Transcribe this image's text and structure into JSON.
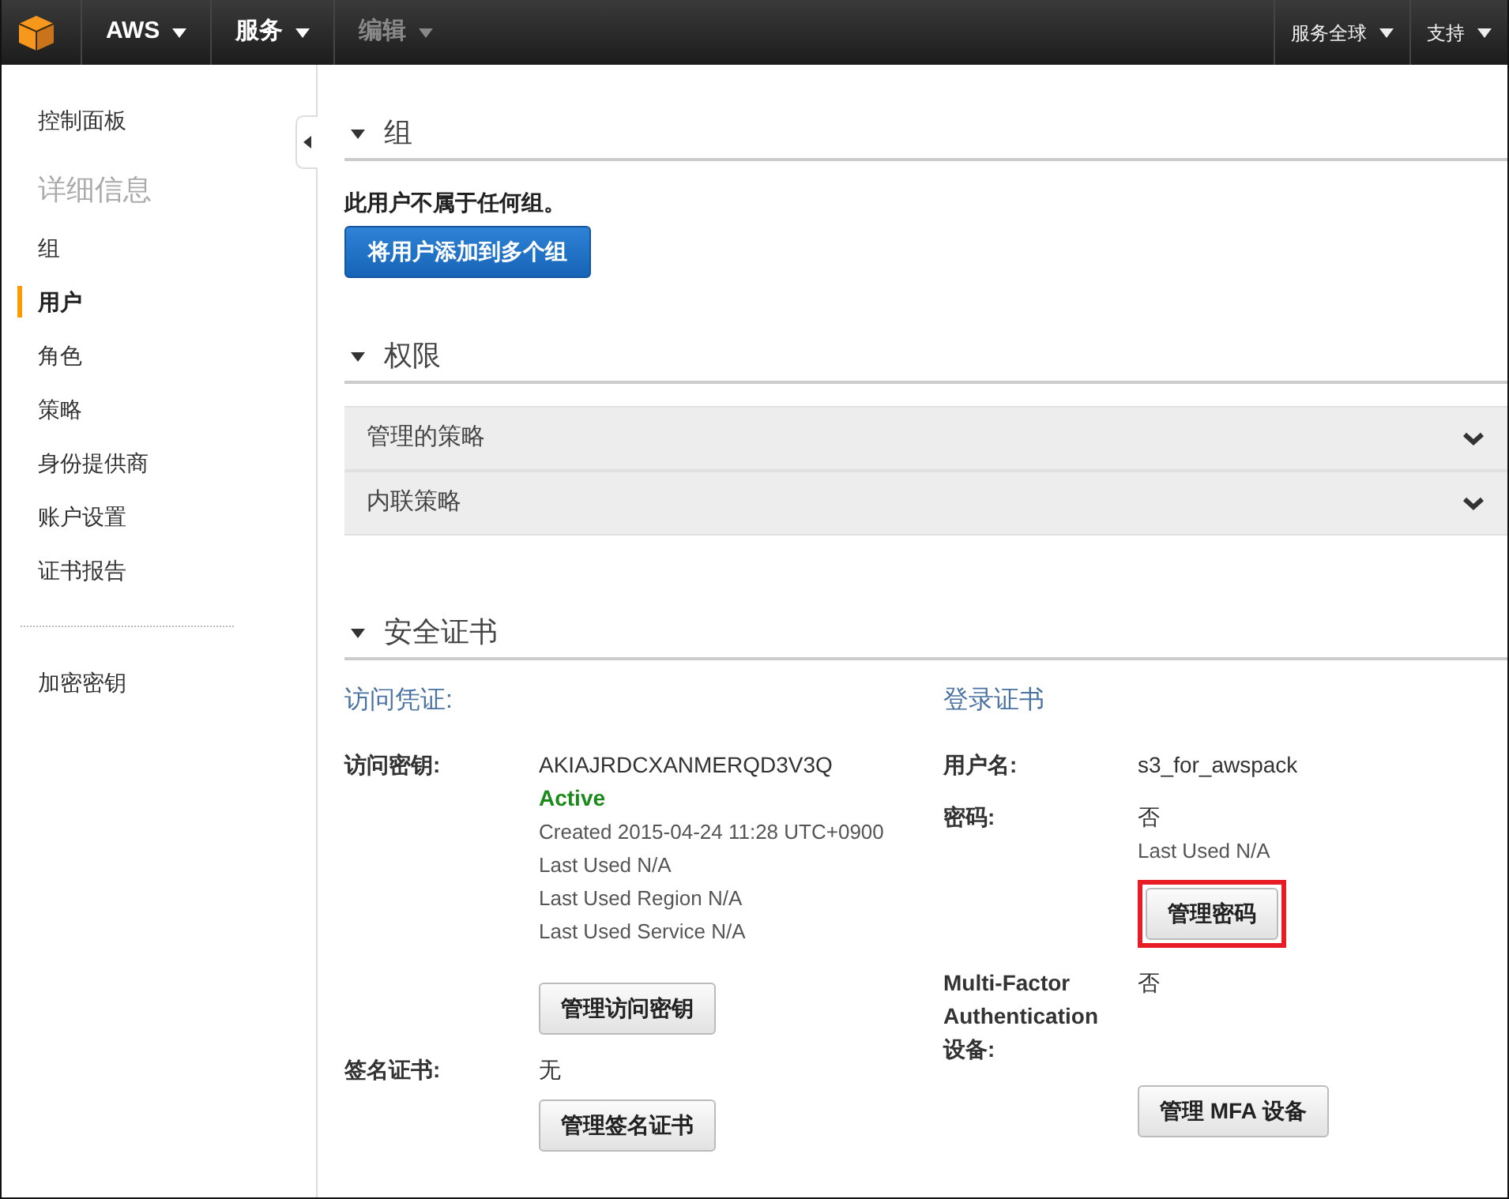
{
  "topbar": {
    "left": [
      {
        "label": "AWS",
        "disabled": false
      },
      {
        "label": "服务",
        "disabled": false
      },
      {
        "label": "编辑",
        "disabled": true
      }
    ],
    "right": [
      {
        "label": "服务全球"
      },
      {
        "label": "支持"
      }
    ]
  },
  "sidebar": {
    "items": [
      {
        "kind": "link",
        "label": "控制面板",
        "selected": false
      },
      {
        "kind": "heading",
        "label": "详细信息"
      },
      {
        "kind": "link",
        "label": "组",
        "selected": false
      },
      {
        "kind": "link",
        "label": "用户",
        "selected": true
      },
      {
        "kind": "link",
        "label": "角色",
        "selected": false
      },
      {
        "kind": "link",
        "label": "策略",
        "selected": false
      },
      {
        "kind": "link",
        "label": "身份提供商",
        "selected": false
      },
      {
        "kind": "link",
        "label": "账户设置",
        "selected": false
      },
      {
        "kind": "link",
        "label": "证书报告",
        "selected": false
      },
      {
        "kind": "divider"
      },
      {
        "kind": "link",
        "label": "加密密钥",
        "selected": false
      }
    ]
  },
  "sections": [
    {
      "kind": "groups",
      "title": "组",
      "expanded": true,
      "message": "此用户不属于任何组。",
      "button": "将用户添加到多个组"
    },
    {
      "kind": "permissions",
      "title": "权限",
      "expanded": true,
      "panels": [
        {
          "label": "管理的策略",
          "expanded": false
        },
        {
          "label": "内联策略",
          "expanded": false
        }
      ]
    },
    {
      "kind": "credentials",
      "title": "安全证书",
      "expanded": true,
      "columns": [
        {
          "title": "访问凭证:",
          "rows": [
            {
              "label": "访问密钥:",
              "lines": [
                {
                  "kind": "value",
                  "text": "AKIAJRDCXANMERQD3V3Q"
                },
                {
                  "kind": "status",
                  "text": "Active"
                },
                {
                  "kind": "meta",
                  "text": "Created 2015-04-24 11:28 UTC+0900"
                },
                {
                  "kind": "meta",
                  "text": "Last Used N/A"
                },
                {
                  "kind": "meta",
                  "text": "Last Used Region N/A"
                },
                {
                  "kind": "meta",
                  "text": "Last Used Service N/A"
                }
              ],
              "button": {
                "label": "管理访问密钥",
                "highlighted": false
              }
            },
            {
              "label": "签名证书:",
              "lines": [
                {
                  "kind": "value",
                  "text": "无"
                }
              ],
              "button": {
                "label": "管理签名证书",
                "highlighted": false
              }
            }
          ]
        },
        {
          "title": "登录证书",
          "rows": [
            {
              "label": "用户名:",
              "lines": [
                {
                  "kind": "value",
                  "text": "s3_for_awspack"
                }
              ]
            },
            {
              "label": "密码:",
              "lines": [
                {
                  "kind": "value",
                  "text": "否"
                },
                {
                  "kind": "meta",
                  "text": "Last Used N/A"
                }
              ],
              "button": {
                "label": "管理密码",
                "highlighted": true
              }
            },
            {
              "label": "Multi-Factor Authentication 设备:",
              "lines": [
                {
                  "kind": "value",
                  "text": "否"
                }
              ],
              "button": {
                "label": "管理 MFA 设备",
                "highlighted": false
              }
            }
          ]
        }
      ]
    }
  ]
}
